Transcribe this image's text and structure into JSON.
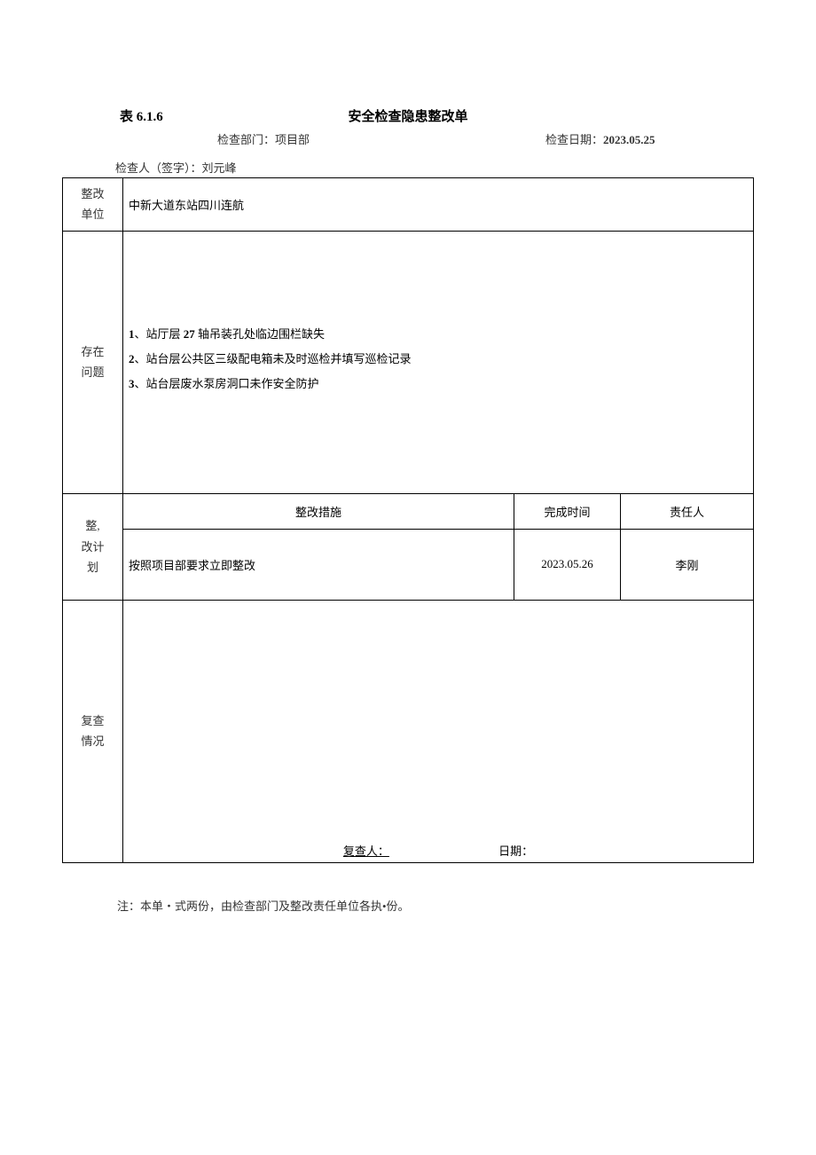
{
  "form_number": "表 6.1.6",
  "form_title": "安全检查隐患整改单",
  "dept_label": "检查部门：",
  "dept_value": "项目部",
  "check_date_label": "检查日期：",
  "check_date_value": "2023.05.25",
  "signer_label": "检查人（签字）：",
  "signer_value": "刘元峰",
  "rows": {
    "unit_label_l1": "整改",
    "unit_label_l2": "单位",
    "unit_value": "中新大道东站四川连航",
    "issues_label_l1": "存在",
    "issues_label_l2": "问题",
    "issues": [
      {
        "num": "1",
        "sep": "、",
        "text_a": "站厅层",
        "text_b": "27",
        "text_c": "轴吊装孔处临边围栏缺失"
      },
      {
        "num": "2",
        "sep": "、",
        "text_a": "站台层公共区三级配电箱未及时巡检并填写巡检记录",
        "text_b": "",
        "text_c": ""
      },
      {
        "num": "3",
        "sep": "、",
        "text_a": "站台层废水泵房洞口未作安全防护",
        "text_b": "",
        "text_c": ""
      }
    ],
    "plan_label_l1": "整,",
    "plan_label_l2": "改计",
    "plan_label_l3": "划",
    "plan_header_measure": "整改措施",
    "plan_header_time": "完成时间",
    "plan_header_resp": "责任人",
    "plan_measure": "按照项目部要求立即整改",
    "plan_time": "2023.05.26",
    "plan_resp": "李刚",
    "review_label_l1": "复查",
    "review_label_l2": "情况",
    "review_reviewer_label": "复查人：",
    "review_date_label": "日期："
  },
  "note": "注：本单・式两份，由检查部门及整改责任单位各执•份。"
}
